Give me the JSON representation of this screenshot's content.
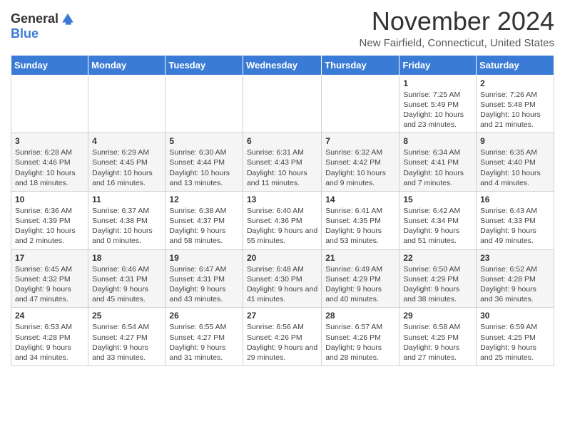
{
  "logo": {
    "general": "General",
    "blue": "Blue"
  },
  "title": "November 2024",
  "subtitle": "New Fairfield, Connecticut, United States",
  "days_of_week": [
    "Sunday",
    "Monday",
    "Tuesday",
    "Wednesday",
    "Thursday",
    "Friday",
    "Saturday"
  ],
  "weeks": [
    [
      {
        "day": "",
        "info": ""
      },
      {
        "day": "",
        "info": ""
      },
      {
        "day": "",
        "info": ""
      },
      {
        "day": "",
        "info": ""
      },
      {
        "day": "",
        "info": ""
      },
      {
        "day": "1",
        "info": "Sunrise: 7:25 AM\nSunset: 5:49 PM\nDaylight: 10 hours and 23 minutes."
      },
      {
        "day": "2",
        "info": "Sunrise: 7:26 AM\nSunset: 5:48 PM\nDaylight: 10 hours and 21 minutes."
      }
    ],
    [
      {
        "day": "3",
        "info": "Sunrise: 6:28 AM\nSunset: 4:46 PM\nDaylight: 10 hours and 18 minutes."
      },
      {
        "day": "4",
        "info": "Sunrise: 6:29 AM\nSunset: 4:45 PM\nDaylight: 10 hours and 16 minutes."
      },
      {
        "day": "5",
        "info": "Sunrise: 6:30 AM\nSunset: 4:44 PM\nDaylight: 10 hours and 13 minutes."
      },
      {
        "day": "6",
        "info": "Sunrise: 6:31 AM\nSunset: 4:43 PM\nDaylight: 10 hours and 11 minutes."
      },
      {
        "day": "7",
        "info": "Sunrise: 6:32 AM\nSunset: 4:42 PM\nDaylight: 10 hours and 9 minutes."
      },
      {
        "day": "8",
        "info": "Sunrise: 6:34 AM\nSunset: 4:41 PM\nDaylight: 10 hours and 7 minutes."
      },
      {
        "day": "9",
        "info": "Sunrise: 6:35 AM\nSunset: 4:40 PM\nDaylight: 10 hours and 4 minutes."
      }
    ],
    [
      {
        "day": "10",
        "info": "Sunrise: 6:36 AM\nSunset: 4:39 PM\nDaylight: 10 hours and 2 minutes."
      },
      {
        "day": "11",
        "info": "Sunrise: 6:37 AM\nSunset: 4:38 PM\nDaylight: 10 hours and 0 minutes."
      },
      {
        "day": "12",
        "info": "Sunrise: 6:38 AM\nSunset: 4:37 PM\nDaylight: 9 hours and 58 minutes."
      },
      {
        "day": "13",
        "info": "Sunrise: 6:40 AM\nSunset: 4:36 PM\nDaylight: 9 hours and 55 minutes."
      },
      {
        "day": "14",
        "info": "Sunrise: 6:41 AM\nSunset: 4:35 PM\nDaylight: 9 hours and 53 minutes."
      },
      {
        "day": "15",
        "info": "Sunrise: 6:42 AM\nSunset: 4:34 PM\nDaylight: 9 hours and 51 minutes."
      },
      {
        "day": "16",
        "info": "Sunrise: 6:43 AM\nSunset: 4:33 PM\nDaylight: 9 hours and 49 minutes."
      }
    ],
    [
      {
        "day": "17",
        "info": "Sunrise: 6:45 AM\nSunset: 4:32 PM\nDaylight: 9 hours and 47 minutes."
      },
      {
        "day": "18",
        "info": "Sunrise: 6:46 AM\nSunset: 4:31 PM\nDaylight: 9 hours and 45 minutes."
      },
      {
        "day": "19",
        "info": "Sunrise: 6:47 AM\nSunset: 4:31 PM\nDaylight: 9 hours and 43 minutes."
      },
      {
        "day": "20",
        "info": "Sunrise: 6:48 AM\nSunset: 4:30 PM\nDaylight: 9 hours and 41 minutes."
      },
      {
        "day": "21",
        "info": "Sunrise: 6:49 AM\nSunset: 4:29 PM\nDaylight: 9 hours and 40 minutes."
      },
      {
        "day": "22",
        "info": "Sunrise: 6:50 AM\nSunset: 4:29 PM\nDaylight: 9 hours and 38 minutes."
      },
      {
        "day": "23",
        "info": "Sunrise: 6:52 AM\nSunset: 4:28 PM\nDaylight: 9 hours and 36 minutes."
      }
    ],
    [
      {
        "day": "24",
        "info": "Sunrise: 6:53 AM\nSunset: 4:28 PM\nDaylight: 9 hours and 34 minutes."
      },
      {
        "day": "25",
        "info": "Sunrise: 6:54 AM\nSunset: 4:27 PM\nDaylight: 9 hours and 33 minutes."
      },
      {
        "day": "26",
        "info": "Sunrise: 6:55 AM\nSunset: 4:27 PM\nDaylight: 9 hours and 31 minutes."
      },
      {
        "day": "27",
        "info": "Sunrise: 6:56 AM\nSunset: 4:26 PM\nDaylight: 9 hours and 29 minutes."
      },
      {
        "day": "28",
        "info": "Sunrise: 6:57 AM\nSunset: 4:26 PM\nDaylight: 9 hours and 28 minutes."
      },
      {
        "day": "29",
        "info": "Sunrise: 6:58 AM\nSunset: 4:25 PM\nDaylight: 9 hours and 27 minutes."
      },
      {
        "day": "30",
        "info": "Sunrise: 6:59 AM\nSunset: 4:25 PM\nDaylight: 9 hours and 25 minutes."
      }
    ]
  ]
}
